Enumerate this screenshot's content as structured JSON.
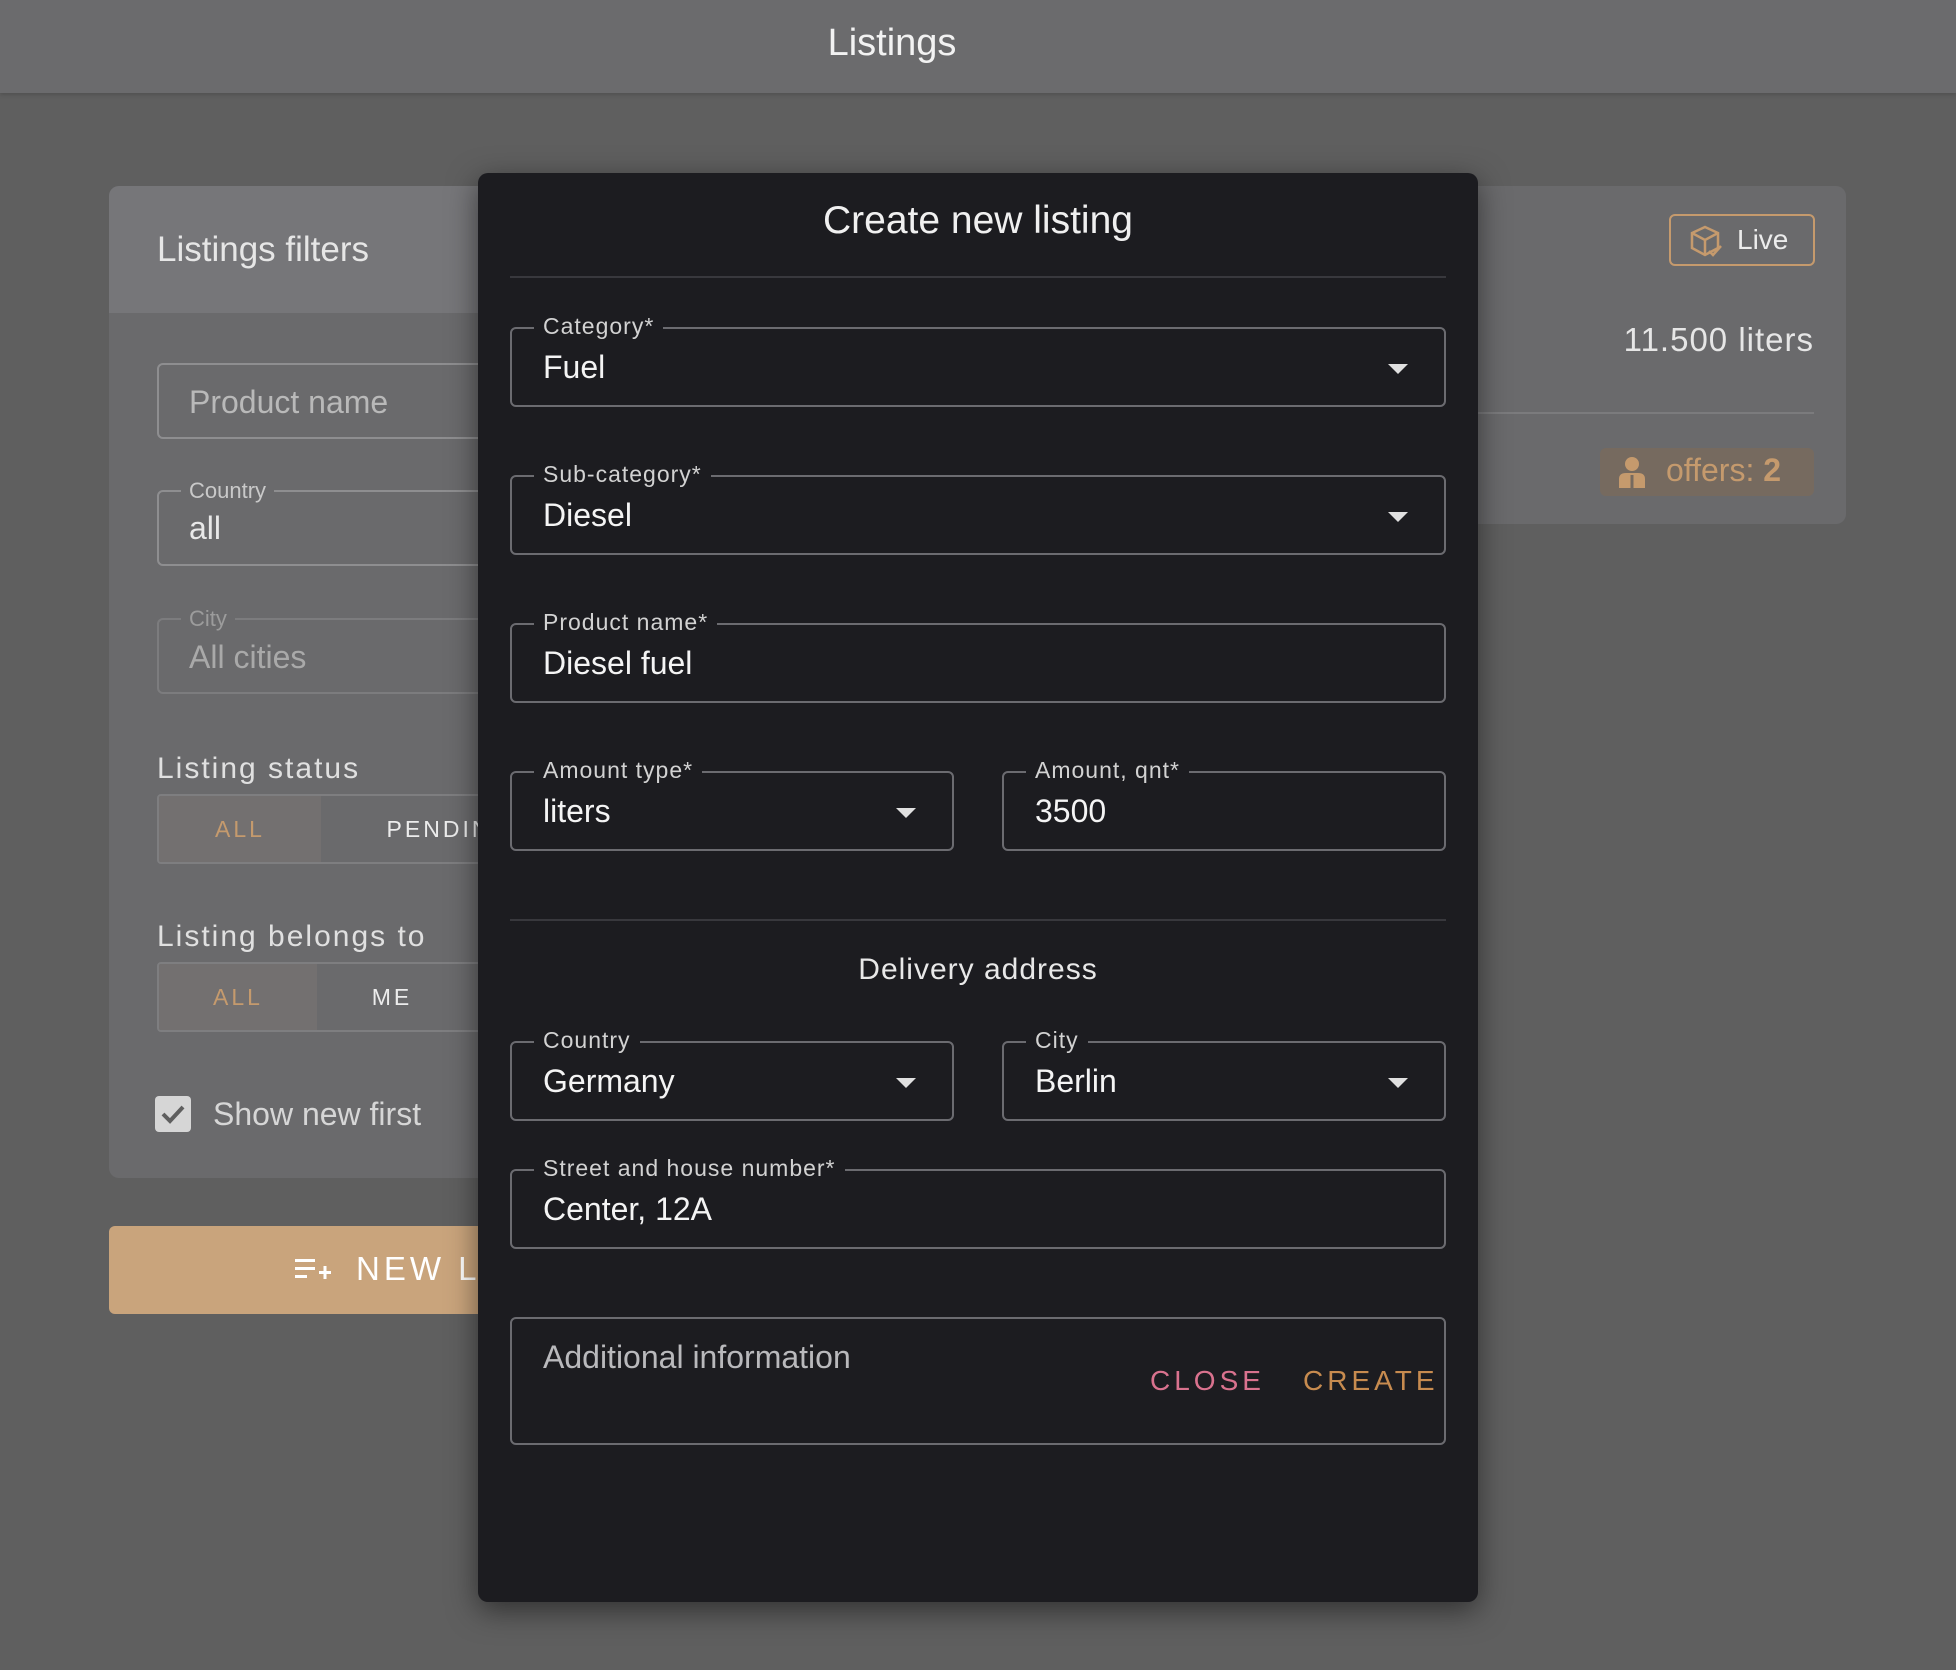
{
  "appbar": {
    "title": "Listings"
  },
  "filters": {
    "title": "Listings filters",
    "product_name_placeholder": "Product name",
    "country": {
      "label": "Country",
      "value": "all"
    },
    "city": {
      "label": "City",
      "placeholder": "All cities"
    },
    "status": {
      "label": "Listing status",
      "options": [
        "ALL",
        "PENDIN"
      ]
    },
    "belongs": {
      "label": "Listing belongs to",
      "options": [
        "ALL",
        "ME"
      ]
    },
    "show_new_first": {
      "label": "Show new first",
      "checked": true
    },
    "new_button": "NEW LI"
  },
  "card": {
    "badge": "Live",
    "amount": "11.500 liters",
    "offers_label": "offers:",
    "offers_count": "2"
  },
  "dialog": {
    "title": "Create new listing",
    "category": {
      "label": "Category*",
      "value": "Fuel"
    },
    "subcategory": {
      "label": "Sub-category*",
      "value": "Diesel"
    },
    "product_name": {
      "label": "Product name*",
      "value": "Diesel fuel"
    },
    "amount_type": {
      "label": "Amount type*",
      "value": "liters"
    },
    "amount_qnt": {
      "label": "Amount, qnt*",
      "value": "3500"
    },
    "delivery_title": "Delivery address",
    "delivery_country": {
      "label": "Country",
      "value": "Germany"
    },
    "delivery_city": {
      "label": "City",
      "value": "Berlin"
    },
    "street": {
      "label": "Street and house number*",
      "value": "Center, 12A"
    },
    "additional_info_placeholder": "Additional information",
    "close_label": "CLOSE",
    "create_label": "CREATE"
  },
  "colors": {
    "accent": "#c59a6d",
    "close": "#d9728e",
    "create": "#c78b4f",
    "dialog_bg": "#1c1c20",
    "backdrop": "#5f5f5f"
  }
}
